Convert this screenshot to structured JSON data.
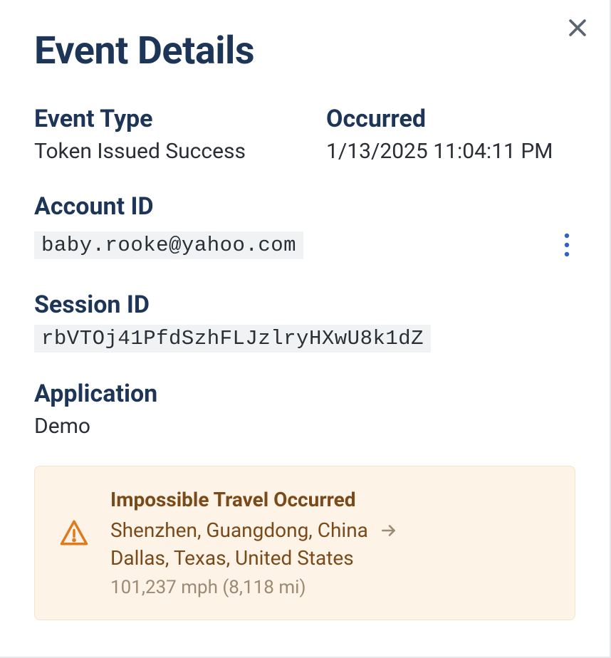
{
  "title": "Event Details",
  "fields": {
    "event_type": {
      "label": "Event Type",
      "value": "Token Issued Success"
    },
    "occurred": {
      "label": "Occurred",
      "value": "1/13/2025 11:04:11 PM"
    },
    "account_id": {
      "label": "Account ID",
      "value": "baby.rooke@yahoo.com"
    },
    "session_id": {
      "label": "Session ID",
      "value": "rbVTOj41PfdSzhFLJzlryHXwU8k1dZ"
    },
    "application": {
      "label": "Application",
      "value": "Demo"
    }
  },
  "alert": {
    "title": "Impossible Travel Occurred",
    "from": "Shenzhen, Guangdong, China",
    "to": "Dallas, Texas, United States",
    "meta": "101,237 mph (8,118 mi)"
  }
}
